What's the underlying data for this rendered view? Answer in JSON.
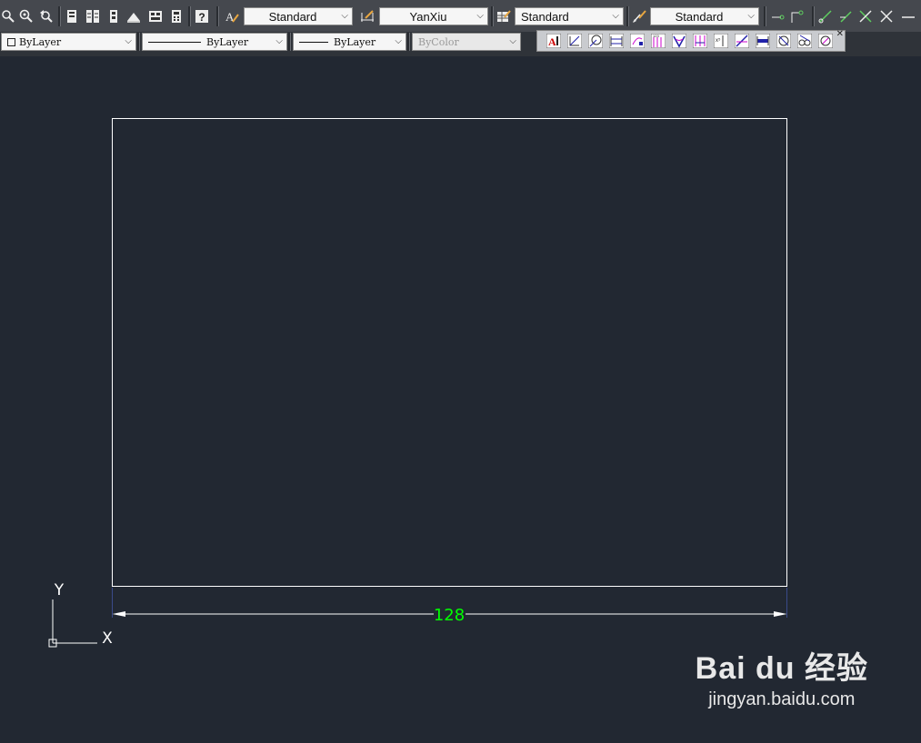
{
  "toolbar1": {
    "text_style": "Standard",
    "dim_style": "YanXiu",
    "table_style": "Standard",
    "multileader_style": "Standard"
  },
  "toolbar2": {
    "layer_color": "ByLayer",
    "linetype": "ByLayer",
    "lineweight": "ByLayer",
    "plot_style": "ByColor"
  },
  "drawing": {
    "dimension_value": "128",
    "ucs_x": "X",
    "ucs_y": "Y"
  },
  "watermark": {
    "logo": "Bai du 经验",
    "url": "jingyan.baidu.com"
  },
  "colors": {
    "background": "#222832",
    "dimension_text": "#00ff00",
    "geometry": "#ffffff"
  }
}
